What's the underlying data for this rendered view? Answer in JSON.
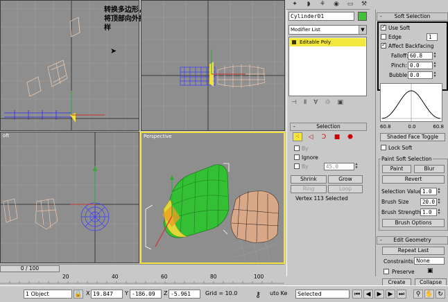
{
  "annotation": "转换多边形，打开软选，将顶部向外提，另一半同样",
  "viewports": {
    "top_left_label": "",
    "bottom_left_label": "oft",
    "perspective_label": "Perspective"
  },
  "command_panel": {
    "object_name": "Cylinder01",
    "object_color": "#3fc235",
    "modifier_list": "Modifier List",
    "stack_item": "Editable Poly",
    "selection": {
      "title": "Selection",
      "by_label": "By",
      "ignore_label": "Ignore",
      "by_angle_label": "By",
      "angle_value": "45.0",
      "shrink": "Shrink",
      "grow": "Grow",
      "ring": "Ring",
      "loop": "Loop",
      "status": "Vertex 113 Selected"
    }
  },
  "soft_selection": {
    "title": "Soft Selection",
    "use_soft": "Use Soft",
    "edge": "Edge",
    "edge_value": "1",
    "affect_backfacing": "Affect Backfacing",
    "falloff_label": "Falloff:",
    "falloff_value": "60.8",
    "pinch_label": "Pinch:",
    "pinch_value": "0.0",
    "bubble_label": "Bubble:",
    "bubble_value": "0.0",
    "curve_left": "60.8",
    "curve_mid": "0.0",
    "curve_right": "60.8",
    "shaded_face_toggle": "Shaded Face Toggle",
    "lock_soft": "Lock Soft",
    "paint_group": "Paint Soft Selection",
    "paint": "Paint",
    "blur": "Blur",
    "revert": "Revert",
    "selection_value_label": "Selection Value",
    "selection_value": "1.0",
    "brush_size_label": "Brush Size",
    "brush_size": "20.0",
    "brush_strength_label": "Brush Strength",
    "brush_strength": "1.0",
    "brush_options": "Brush Options"
  },
  "edit_geometry": {
    "title": "Edit Geometry",
    "repeat_last": "Repeat Last",
    "constraints_label": "Constraints:",
    "constraints_value": "None",
    "preserve": "Preserve",
    "create": "Create",
    "collapse": "Collapse"
  },
  "timeline": {
    "slider": "0 / 100",
    "ticks": [
      "20",
      "40",
      "60",
      "80",
      "100"
    ]
  },
  "status": {
    "objects": "1 Object",
    "x_label": "X",
    "x_value": "19.847",
    "y_label": "Y",
    "y_value": "-186.09",
    "z_label": "Z",
    "z_value": "-5.961",
    "grid": "Grid = 10.0",
    "auto_key": "uto Ke",
    "key_mode": "Selected"
  }
}
